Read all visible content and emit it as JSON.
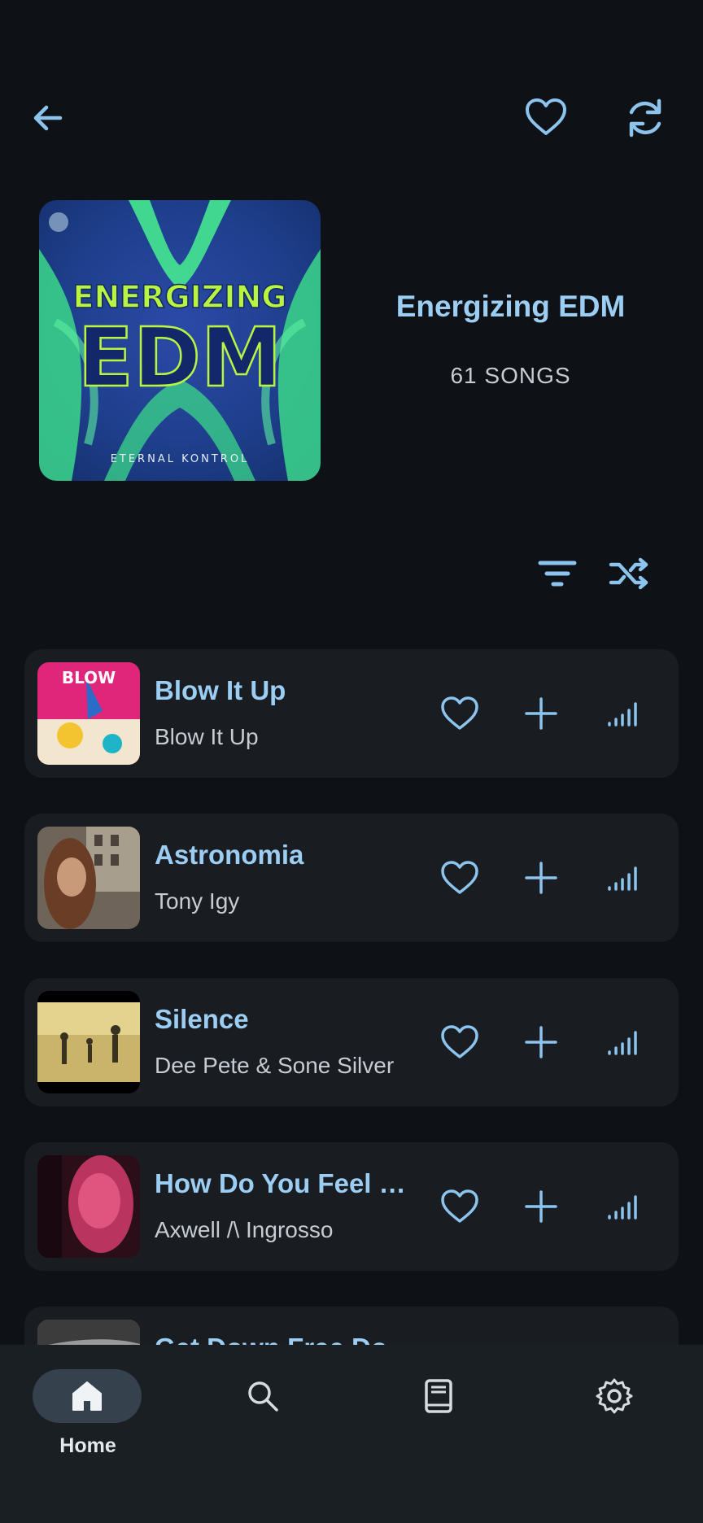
{
  "header": {
    "back_icon": "arrow-left-icon",
    "favorite_icon": "heart-icon",
    "sync_icon": "refresh-icon"
  },
  "playlist": {
    "cover_text_line1": "ENERGIZING",
    "cover_text_line2": "EDM",
    "cover_footer": "ETERNAL KONTROL",
    "title": "Energizing EDM",
    "count": "61 SONGS"
  },
  "tools": {
    "sort_icon": "filter-icon",
    "shuffle_icon": "shuffle-icon"
  },
  "songs": [
    {
      "title": "Blow It Up",
      "artist": "Blow It Up"
    },
    {
      "title": "Astronomia",
      "artist": "Tony Igy"
    },
    {
      "title": "Silence",
      "artist": "Dee Pete & Sone Silver"
    },
    {
      "title": "How Do You Feel R...",
      "artist": "Axwell /\\ Ingrosso"
    },
    {
      "title": "Get Down Free Do",
      "artist": ""
    }
  ],
  "nav": {
    "home": "Home",
    "items": [
      "home-icon",
      "search-icon",
      "library-icon",
      "settings-icon"
    ]
  },
  "colors": {
    "accent": "#9ccdf2",
    "background": "#0e1216",
    "card": "#191d22",
    "nav_pill": "#35414c"
  }
}
